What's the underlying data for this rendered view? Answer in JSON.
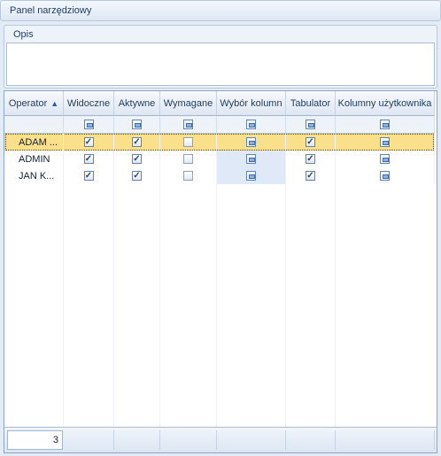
{
  "toolbar": {
    "title": "Panel narzędziowy"
  },
  "description": {
    "title": "Opis",
    "value": ""
  },
  "grid": {
    "columns": [
      {
        "key": "operator",
        "label": "Operator",
        "sorted": "asc"
      },
      {
        "key": "visible",
        "label": "Widoczne"
      },
      {
        "key": "active",
        "label": "Aktywne"
      },
      {
        "key": "required",
        "label": "Wymagane"
      },
      {
        "key": "column_select",
        "label": "Wybór kolumn"
      },
      {
        "key": "tab",
        "label": "Tabulator"
      },
      {
        "key": "user_columns",
        "label": "Kolumny użytkownika"
      }
    ],
    "rows": [
      {
        "operator": "ADAM ...",
        "visible": "checked",
        "active": "checked",
        "required": "unchecked",
        "column_select": "indeterminate",
        "tab": "checked",
        "user_columns": "indeterminate",
        "selected": true
      },
      {
        "operator": "ADMIN",
        "visible": "checked",
        "active": "checked",
        "required": "unchecked",
        "column_select": "indeterminate",
        "tab": "checked",
        "user_columns": "indeterminate",
        "selected": false
      },
      {
        "operator": "JAN K...",
        "visible": "checked",
        "active": "checked",
        "required": "unchecked",
        "column_select": "indeterminate",
        "tab": "checked",
        "user_columns": "indeterminate",
        "selected": false
      }
    ],
    "footer": {
      "count": "3"
    }
  },
  "colors": {
    "selected_row": "#fbe08c",
    "shaded_column": "#dfe9f8",
    "header": "#dfe7f2"
  }
}
